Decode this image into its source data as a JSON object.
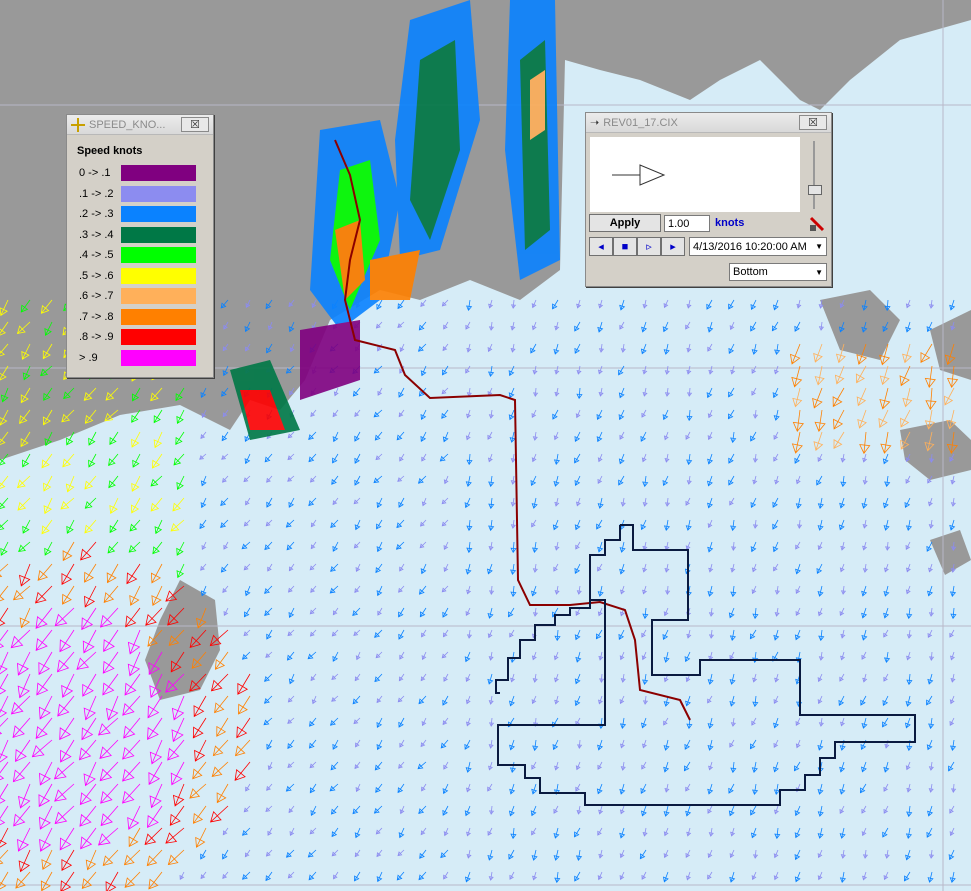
{
  "legend": {
    "title": "SPEED_KNO...",
    "heading": "Speed knots",
    "close_label": "☒",
    "ranges": [
      {
        "label": "0 -> .1",
        "color": "#800080"
      },
      {
        "label": ".1 -> .2",
        "color": "#8c8cf0"
      },
      {
        "label": ".2 -> .3",
        "color": "#0a82ff"
      },
      {
        "label": ".3 -> .4",
        "color": "#007846"
      },
      {
        "label": ".4 -> .5",
        "color": "#00ff00"
      },
      {
        "label": ".5 -> .6",
        "color": "#ffff00"
      },
      {
        "label": ".6 -> .7",
        "color": "#ffb05a"
      },
      {
        "label": ".7 -> .8",
        "color": "#ff8000"
      },
      {
        "label": ".8 -> .9",
        "color": "#ff0000"
      },
      {
        "label": "> .9",
        "color": "#ff00ff"
      }
    ]
  },
  "control": {
    "title": "REV01_17.CIX",
    "close_label": "☒",
    "apply_label": "Apply",
    "scale_value": "1.00",
    "scale_unit": "knots",
    "datetime": "4/13/2016 10:20:00 AM",
    "layer": "Bottom",
    "playback": {
      "step_back": "◂",
      "stop": "■",
      "step_forward": "▹",
      "play": "▸"
    }
  },
  "colors": {
    "water": "#d6ecf7",
    "land": "#999999",
    "track_red": "#8b0000",
    "survey_outline": "#0a1a40",
    "graticule": "#b8b8c8"
  }
}
